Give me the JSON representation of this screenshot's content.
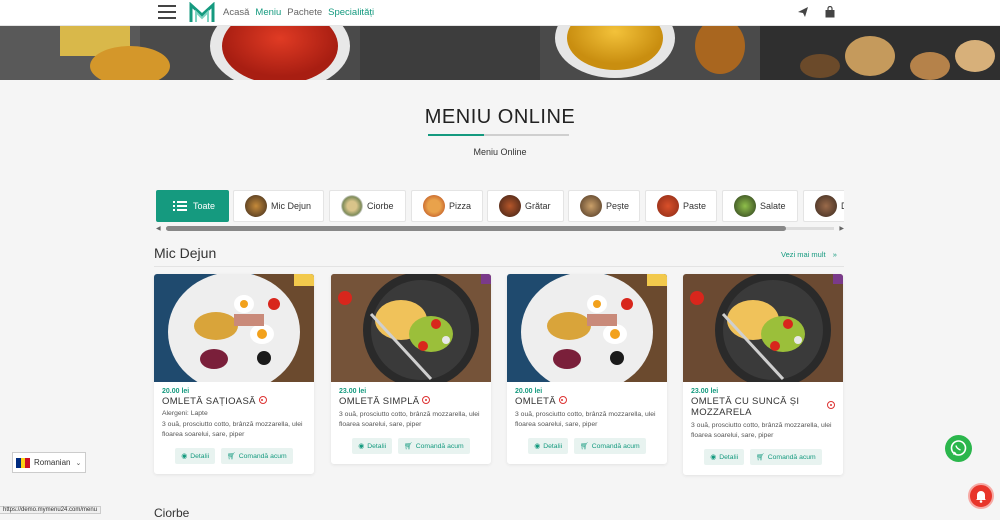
{
  "nav": {
    "items": [
      {
        "label": "Acasă",
        "active": false
      },
      {
        "label": "Meniu",
        "active": true
      },
      {
        "label": "Pachete",
        "active": false
      },
      {
        "label": "Specialități",
        "active": false
      }
    ],
    "icons": [
      "menu-icon",
      "logo-icon",
      "send-icon",
      "shopping-bag-icon"
    ]
  },
  "header": {
    "title": "MENIU ONLINE",
    "subtitle": "Meniu Online"
  },
  "categories": [
    {
      "label": "Toate",
      "icon": "list-icon",
      "active": true
    },
    {
      "label": "Mic Dejun",
      "icon": "food-icon",
      "active": false
    },
    {
      "label": "Ciorbe",
      "icon": "food-icon",
      "active": false
    },
    {
      "label": "Pizza",
      "icon": "food-icon",
      "active": false
    },
    {
      "label": "Grătar",
      "icon": "food-icon",
      "active": false
    },
    {
      "label": "Pește",
      "icon": "food-icon",
      "active": false
    },
    {
      "label": "Paste",
      "icon": "food-icon",
      "active": false
    },
    {
      "label": "Salate",
      "icon": "food-icon",
      "active": false
    },
    {
      "label": "D",
      "icon": "food-icon",
      "active": false
    }
  ],
  "section": {
    "title": "Mic Dejun",
    "see_more": "Vezi mai mult",
    "next_title": "Ciorbe"
  },
  "products": [
    {
      "price": "20.00 lei",
      "name": "OMLETĂ SAȚIOASĂ",
      "allergens": "Alergeni: Lapte",
      "desc": "3 ouă, prosciutto cotto, brânză mozzarella, ulei floarea soarelui, sare, piper",
      "details": "Detalii",
      "order": "Comandă acum"
    },
    {
      "price": "23.00 lei",
      "name": "OMLETĂ SIMPLĂ",
      "allergens": "",
      "desc": "3 ouă, prosciutto cotto, brânză mozzarella, ulei floarea soarelui, sare, piper",
      "details": "Detalii",
      "order": "Comandă acum"
    },
    {
      "price": "20.00 lei",
      "name": "OMLETĂ",
      "allergens": "",
      "desc": "3 ouă, prosciutto cotto, brânză mozzarella, ulei floarea soarelui, sare, piper",
      "details": "Detalii",
      "order": "Comandă acum"
    },
    {
      "price": "23.00 lei",
      "name": "OMLETĂ CU SUNCĂ ȘI MOZZARELA",
      "allergens": "",
      "desc": "3 ouă, prosciutto cotto, brânză mozzarella, ulei floarea soarelui, sare, piper",
      "details": "Detalii",
      "order": "Comandă acum"
    }
  ],
  "language": {
    "label": "Romanian",
    "flag_colors": [
      "#002b7f",
      "#fcd116",
      "#ce1126"
    ]
  },
  "status_url": "https://demo.mymenu24.com/menu",
  "colors": {
    "accent": "#159a7f",
    "whatsapp": "#2bb64c",
    "notification": "#e8352b"
  }
}
